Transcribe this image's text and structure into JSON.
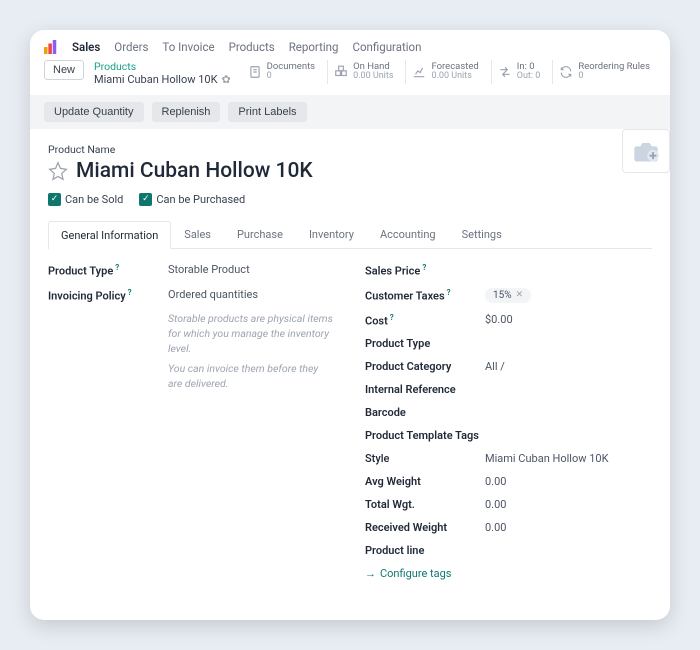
{
  "menubar": {
    "brand": "Sales",
    "items": [
      "Orders",
      "To Invoice",
      "Products",
      "Reporting",
      "Configuration"
    ]
  },
  "crumb": {
    "new": "New",
    "top": "Products",
    "bottom": "Miami Cuban Hollow 10K"
  },
  "indicators": [
    {
      "label": "Documents",
      "value": "0"
    },
    {
      "label": "On Hand",
      "value": "0.00 Units"
    },
    {
      "label": "Forecasted",
      "value": "0.00 Units"
    },
    {
      "label": "In: 0",
      "value": "Out: 0"
    },
    {
      "label": "Reordering Rules",
      "value": "0"
    }
  ],
  "actions": {
    "update": "Update Quantity",
    "replenish": "Replenish",
    "print": "Print Labels"
  },
  "product": {
    "name_label": "Product Name",
    "name": "Miami Cuban Hollow 10K",
    "can_be_sold": "Can be Sold",
    "can_be_purchased": "Can be Purchased"
  },
  "tabs": [
    "General Information",
    "Sales",
    "Purchase",
    "Inventory",
    "Accounting",
    "Settings"
  ],
  "left": {
    "product_type_label": "Product Type",
    "product_type": "Storable Product",
    "invoicing_label": "Invoicing Policy",
    "invoicing": "Ordered quantities",
    "hint1": "Storable products are physical items for which you manage the inventory level.",
    "hint2": "You can invoice them before they are delivered."
  },
  "right": {
    "sales_price_label": "Sales Price",
    "customer_taxes_label": "Customer Taxes",
    "customer_taxes_tag": "15%",
    "cost_label": "Cost",
    "cost": "$0.00",
    "ptype_label": "Product Type",
    "pcat_label": "Product Category",
    "pcat": "All /",
    "iref_label": "Internal Reference",
    "barcode_label": "Barcode",
    "ptt_label": "Product Template Tags",
    "style_label": "Style",
    "style": "Miami Cuban Hollow 10K",
    "avgw_label": "Avg Weight",
    "avgw": "0.00",
    "totw_label": "Total Wgt.",
    "totw": "0.00",
    "recw_label": "Received Weight",
    "recw": "0.00",
    "pline_label": "Product line",
    "configure": "Configure tags"
  }
}
